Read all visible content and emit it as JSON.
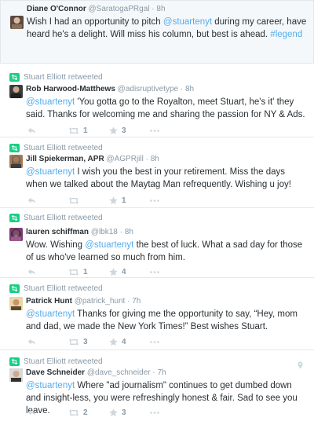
{
  "tweets": [
    {
      "retweeted_by": "",
      "name": "Diane O'Connor",
      "handle": "@SaratogaPRgal",
      "time": "8h",
      "text_before": "Wish I had an opportunity to pitch ",
      "mention": "@stuartenyt",
      "text_after": " during my career, have heard he's a delight. Will miss his column, but best is ahead. ",
      "hashtag": "#legend",
      "retweets": "",
      "favorites": "",
      "avatar_color": "#5a4a3f"
    },
    {
      "retweeted_by": "Stuart Elliott retweeted",
      "name": "Rob Harwood-Matthews",
      "handle": "@adisruptivetype",
      "time": "8h",
      "text_before": "",
      "mention": "@stuartenyt",
      "text_after": " 'You gotta go to the Royalton, meet Stuart, he's it' they said. Thanks for welcoming me and sharing the passion for NY & Ads.",
      "hashtag": "",
      "retweets": "1",
      "favorites": "3",
      "avatar_color": "#3b3b3b"
    },
    {
      "retweeted_by": "Stuart Elliott retweeted",
      "name": "Jill Spiekerman, APR",
      "handle": "@AGPRjill",
      "time": "8h",
      "text_before": "",
      "mention": "@stuartenyt",
      "text_after": " I wish you the best in your retirement. Miss the days when we talked about the Maytag Man refrequently. Wishing u joy!",
      "hashtag": "",
      "retweets": "",
      "favorites": "1",
      "avatar_color": "#a07a5c"
    },
    {
      "retweeted_by": "Stuart Elliott retweeted",
      "name": "lauren schiffman",
      "handle": "@lbk18",
      "time": "8h",
      "text_before": "Wow. Wishing ",
      "mention": "@stuartenyt",
      "text_after": " the best of luck. What a sad day for those of us who've learned so much from him.",
      "hashtag": "",
      "retweets": "1",
      "favorites": "4",
      "avatar_color": "#7a3d6e"
    },
    {
      "retweeted_by": "Stuart Elliott retweeted",
      "name": "Patrick Hunt",
      "handle": "@patrick_hunt",
      "time": "7h",
      "text_before": "",
      "mention": "@stuartenyt",
      "text_after": " Thanks for giving me the opportunity to say, “Hey, mom and dad, we made the New York Times!” Best wishes Stuart.",
      "hashtag": "",
      "retweets": "3",
      "favorites": "4",
      "avatar_color": "#b58d4c"
    },
    {
      "retweeted_by": "Stuart Elliott retweeted",
      "name": "Dave Schneider",
      "handle": "@dave_schneider",
      "time": "7h",
      "text_before": "",
      "mention": "@stuartenyt",
      "text_after": " Where \"ad journalism\" continues to get dumbed down and insight-less, you were refreshingly honest & fair. Sad to see you leave.",
      "hashtag": "",
      "retweets": "2",
      "favorites": "3",
      "avatar_color": "#4a4a4a"
    }
  ],
  "colors": {
    "link": "#55acee",
    "retweet_green": "#19cf86",
    "muted": "#8899a6"
  },
  "icons": [
    "retweet-badge-icon",
    "reply-icon",
    "retweet-icon",
    "favorite-star-icon",
    "more-icon",
    "location-icon"
  ]
}
